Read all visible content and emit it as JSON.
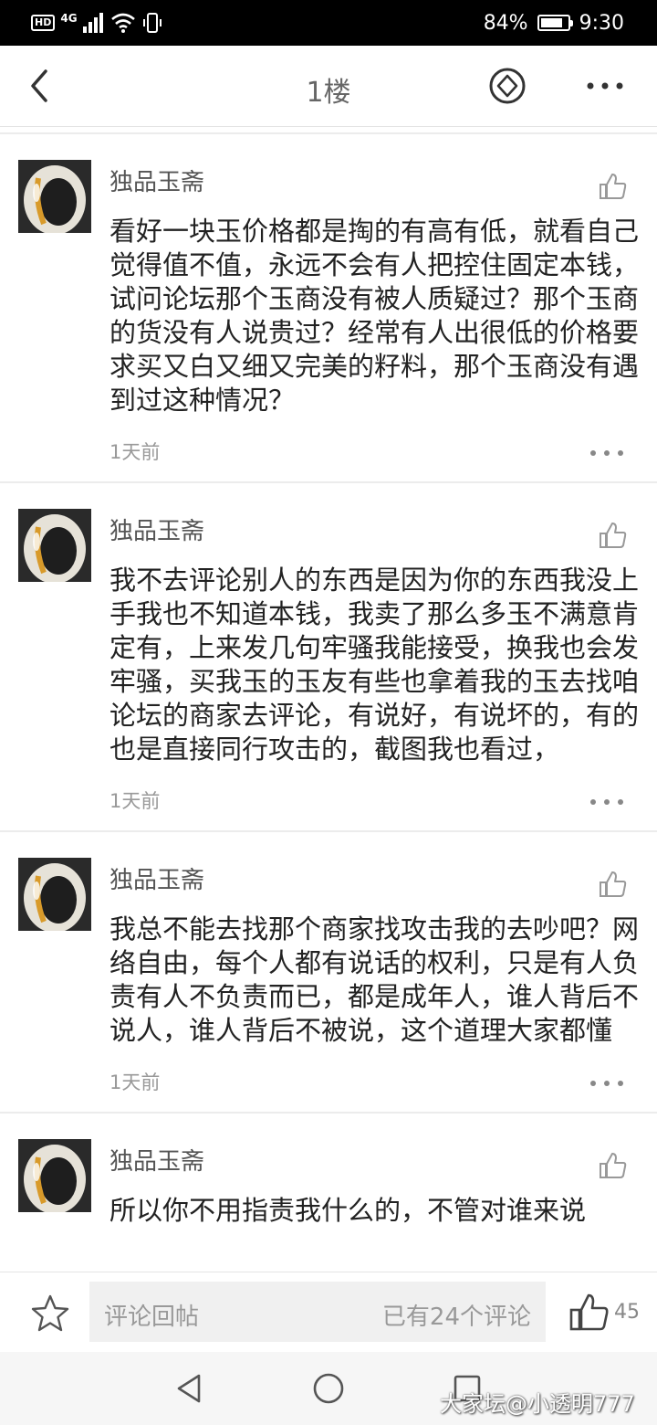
{
  "status_bar": {
    "network": "4G",
    "battery_level": 84,
    "battery_text": "84%",
    "time": "9:30"
  },
  "nav": {
    "title": "1楼"
  },
  "comments": [
    {
      "username": "独品玉斋",
      "text": "看好一块玉价格都是掏的有高有低，就看自己觉得值不值，永远不会有人把控住固定本钱，试问论坛那个玉商没有被人质疑过？那个玉商的货没有人说贵过？经常有人出很低的价格要求买又白又细又完美的籽料，那个玉商没有遇到过这种情况？",
      "time": "1天前"
    },
    {
      "username": "独品玉斋",
      "text": "我不去评论别人的东西是因为你的东西我没上手我也不知道本钱，我卖了那么多玉不满意肯定有，上来发几句牢骚我能接受，换我也会发牢骚，买我玉的玉友有些也拿着我的玉去找咱论坛的商家去评论，有说好，有说坏的，有的也是直接同行攻击的，截图我也看过，",
      "time": "1天前"
    },
    {
      "username": "独品玉斋",
      "text": "我总不能去找那个商家找攻击我的去吵吧？网络自由，每个人都有说话的权利，只是有人负责有人不负责而已，都是成年人，谁人背后不说人，谁人背后不被说，这个道理大家都懂",
      "time": "1天前"
    },
    {
      "username": "独品玉斋",
      "text": "所以你不用指责我什么的，不管对谁来说",
      "time": ""
    }
  ],
  "bottom_bar": {
    "reply_placeholder": "评论回帖",
    "comment_count": "已有24个评论",
    "like_count": "45"
  },
  "watermark": "大家坛@小透明777",
  "colors": {
    "status_bar_bg": "#000000",
    "divider": "#ececec",
    "muted_text": "#999999"
  }
}
